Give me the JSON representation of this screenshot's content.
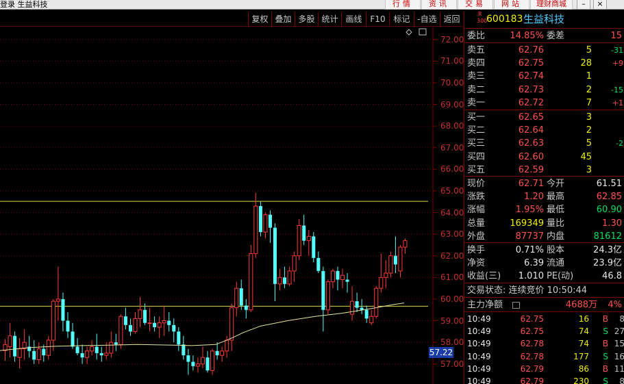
{
  "app": {
    "title": "登录 生益科技"
  },
  "top_nav": [
    "行情",
    "资讯",
    "交易",
    "网站",
    "理财商城"
  ],
  "window_controls": [
    "–",
    "×"
  ],
  "toolbar": [
    "复权",
    "叠加",
    "多股",
    "统计",
    "画线",
    "F10",
    "标记",
    "-自选",
    "返回"
  ],
  "chart": {
    "y_labels": [
      "72.00",
      "71.00",
      "70.00",
      "69.00",
      "68.00",
      "67.00",
      "66.00",
      "65.00",
      "64.00",
      "63.00",
      "62.00",
      "61.00",
      "60.00",
      "59.00",
      "58.00",
      "57.00"
    ],
    "current_marker": "57.22",
    "colors": {
      "up": "#ff3a3a",
      "down": "#54fcfc",
      "ma": "#e8e8a0",
      "hline": "#d8d850",
      "grid": "#7a0000"
    }
  },
  "chart_data": {
    "type": "candlestick",
    "ylim": [
      56.5,
      72.5
    ],
    "hlines": [
      64.52,
      59.67
    ],
    "candles": [
      [
        57.62,
        58.15,
        57.15,
        57.9
      ],
      [
        57.8,
        58.9,
        57.3,
        58.3
      ],
      [
        58.3,
        58.5,
        57.1,
        57.35
      ],
      [
        57.3,
        58.2,
        56.8,
        57.7
      ],
      [
        57.7,
        58.6,
        57.2,
        58.0
      ],
      [
        57.8,
        58.3,
        57.3,
        57.6
      ],
      [
        57.6,
        58.1,
        57.0,
        57.2
      ],
      [
        57.2,
        58.0,
        57.0,
        57.7
      ],
      [
        57.7,
        57.9,
        57.1,
        57.4
      ],
      [
        57.4,
        58.3,
        57.2,
        58.1
      ],
      [
        58.1,
        60.0,
        57.6,
        59.9
      ],
      [
        59.9,
        61.5,
        59.0,
        60.0
      ],
      [
        60.0,
        60.3,
        58.5,
        59.0
      ],
      [
        59.0,
        59.4,
        58.2,
        58.5
      ],
      [
        58.5,
        58.9,
        57.7,
        57.8
      ],
      [
        57.8,
        58.2,
        57.4,
        57.5
      ],
      [
        57.5,
        57.9,
        57.0,
        57.3
      ],
      [
        57.3,
        57.8,
        57.0,
        57.6
      ],
      [
        57.6,
        58.1,
        57.4,
        57.8
      ],
      [
        57.8,
        58.4,
        57.2,
        57.5
      ],
      [
        57.5,
        57.8,
        57.1,
        57.4
      ],
      [
        57.4,
        58.0,
        57.2,
        57.5
      ],
      [
        57.5,
        58.5,
        57.3,
        58.0
      ],
      [
        58.0,
        58.4,
        57.6,
        57.9
      ],
      [
        57.9,
        59.3,
        57.7,
        59.2
      ],
      [
        59.2,
        59.6,
        58.6,
        58.8
      ],
      [
        58.8,
        59.1,
        58.3,
        58.5
      ],
      [
        58.5,
        59.4,
        58.4,
        59.1
      ],
      [
        59.1,
        60.1,
        58.7,
        59.5
      ],
      [
        59.5,
        59.8,
        58.8,
        58.9
      ],
      [
        58.9,
        59.6,
        58.5,
        58.9
      ],
      [
        58.9,
        59.2,
        58.5,
        58.7
      ],
      [
        58.7,
        59.2,
        58.2,
        58.9
      ],
      [
        58.9,
        59.7,
        58.3,
        59.0
      ],
      [
        59.0,
        59.4,
        58.5,
        58.8
      ],
      [
        58.8,
        59.1,
        58.0,
        58.5
      ],
      [
        58.5,
        58.7,
        57.6,
        57.9
      ],
      [
        57.9,
        58.3,
        57.2,
        57.4
      ],
      [
        57.4,
        57.7,
        56.5,
        57.1
      ],
      [
        57.1,
        57.4,
        56.7,
        56.9
      ],
      [
        56.9,
        57.3,
        56.6,
        57.0
      ],
      [
        57.0,
        57.8,
        56.8,
        57.3
      ],
      [
        57.3,
        57.6,
        56.6,
        56.7
      ],
      [
        56.7,
        57.7,
        56.5,
        57.6
      ],
      [
        57.6,
        58.0,
        57.2,
        57.4
      ],
      [
        57.4,
        57.8,
        57.1,
        57.6
      ],
      [
        57.6,
        58.3,
        57.3,
        58.1
      ],
      [
        58.1,
        59.8,
        57.6,
        59.6
      ],
      [
        59.6,
        60.8,
        59.2,
        60.5
      ],
      [
        60.5,
        60.9,
        59.5,
        59.7
      ],
      [
        59.7,
        60.0,
        59.1,
        59.5
      ],
      [
        59.5,
        62.5,
        59.4,
        62.1
      ],
      [
        62.1,
        64.9,
        61.9,
        64.3
      ],
      [
        64.3,
        64.5,
        62.9,
        63.1
      ],
      [
        63.1,
        64.0,
        62.8,
        63.9
      ],
      [
        63.9,
        64.1,
        62.6,
        63.3
      ],
      [
        63.3,
        63.5,
        59.9,
        60.7
      ],
      [
        60.7,
        61.4,
        60.4,
        61.0
      ],
      [
        61.0,
        61.5,
        60.5,
        60.7
      ],
      [
        60.7,
        61.5,
        60.6,
        61.3
      ],
      [
        61.3,
        62.2,
        60.8,
        62.0
      ],
      [
        62.0,
        63.7,
        61.8,
        63.4
      ],
      [
        63.4,
        63.9,
        62.5,
        62.7
      ],
      [
        62.7,
        63.2,
        62.0,
        62.9
      ],
      [
        62.9,
        63.1,
        61.7,
        61.9
      ],
      [
        61.9,
        62.2,
        61.2,
        61.3
      ],
      [
        61.3,
        61.5,
        58.5,
        59.5
      ],
      [
        59.5,
        60.9,
        59.3,
        60.8
      ],
      [
        60.8,
        61.4,
        60.5,
        61.3
      ],
      [
        61.3,
        61.5,
        60.4,
        60.9
      ],
      [
        60.9,
        61.4,
        60.5,
        61.1
      ],
      [
        60.9,
        61.2,
        60.3,
        60.8
      ],
      [
        59.3,
        60.6,
        59.0,
        59.9
      ],
      [
        59.9,
        60.3,
        59.4,
        59.6
      ],
      [
        59.6,
        60.0,
        59.3,
        59.5
      ],
      [
        59.5,
        59.7,
        58.9,
        59.1
      ],
      [
        58.9,
        59.5,
        58.8,
        59.2
      ],
      [
        59.2,
        60.6,
        59.1,
        60.5
      ],
      [
        60.5,
        62.1,
        60.3,
        61.0
      ],
      [
        61.0,
        61.8,
        60.5,
        61.2
      ],
      [
        61.2,
        62.2,
        61.0,
        62.0
      ],
      [
        62.0,
        62.9,
        61.2,
        61.6
      ],
      [
        61.3,
        62.5,
        61.0,
        62.4
      ],
      [
        62.4,
        62.8,
        62.1,
        62.7
      ]
    ],
    "ma": [
      [
        0,
        57.62
      ],
      [
        40,
        57.75
      ],
      [
        80,
        57.82
      ],
      [
        120,
        57.85
      ],
      [
        160,
        57.87
      ],
      [
        200,
        57.9
      ],
      [
        240,
        57.88
      ],
      [
        280,
        57.85
      ],
      [
        315,
        57.9
      ],
      [
        335,
        58.15
      ],
      [
        355,
        58.45
      ],
      [
        380,
        58.75
      ],
      [
        420,
        59.0
      ],
      [
        460,
        59.2
      ],
      [
        500,
        59.35
      ],
      [
        540,
        59.55
      ],
      [
        575,
        59.75
      ],
      [
        590,
        59.82
      ]
    ]
  },
  "panel": {
    "symbol": "600183",
    "name": "生益科技",
    "market_tag_top": "R",
    "market_tag_bottom": "300",
    "weibi": {
      "label": "委比",
      "value": "14.85%",
      "label2": "委差",
      "value2": "15"
    },
    "asks": [
      {
        "label": "卖五",
        "price": "62.76",
        "vol": "5",
        "chg": "-31"
      },
      {
        "label": "卖四",
        "price": "62.75",
        "vol": "28",
        "chg": "+9"
      },
      {
        "label": "卖三",
        "price": "62.74",
        "vol": "1",
        "chg": ""
      },
      {
        "label": "卖二",
        "price": "62.73",
        "vol": "2",
        "chg": "-15"
      },
      {
        "label": "卖一",
        "price": "62.72",
        "vol": "7",
        "chg": "+1"
      }
    ],
    "bids": [
      {
        "label": "买一",
        "price": "62.65",
        "vol": "3",
        "chg": ""
      },
      {
        "label": "买二",
        "price": "62.64",
        "vol": "2",
        "chg": ""
      },
      {
        "label": "买三",
        "price": "62.63",
        "vol": "5",
        "chg": "-2"
      },
      {
        "label": "买四",
        "price": "62.60",
        "vol": "45",
        "chg": ""
      },
      {
        "label": "买五",
        "price": "62.59",
        "vol": "3",
        "chg": ""
      }
    ],
    "quote": [
      {
        "l1": "现价",
        "v1": "62.71",
        "l2": "今开",
        "v2": "61.51"
      },
      {
        "l1": "涨跌",
        "v1": "1.20",
        "l2": "最高",
        "v2": "62.85"
      },
      {
        "l1": "涨幅",
        "v1": "1.95%",
        "l2": "最低",
        "v2": "60.90"
      },
      {
        "l1": "总量",
        "v1": "169349",
        "l2": "量比",
        "v2": "1.30"
      },
      {
        "l1": "外盘",
        "v1": "87737",
        "l2": "内盘",
        "v2": "81612"
      }
    ],
    "stats": [
      {
        "l1": "换手",
        "v1": "0.71%",
        "l2": "股本",
        "v2": "24.3亿"
      },
      {
        "l1": "净资",
        "v1": "6.39",
        "l2": "流通",
        "v2": "23.9亿"
      },
      {
        "l1": "收益(三)",
        "v1": "1.010",
        "l2": "PE(动)",
        "v2": "46.8"
      }
    ],
    "trade_status": "交易状态: 连续竞价 10:50:44",
    "main_flow": {
      "label": "主力净额",
      "value": "4688万",
      "pct": "4%"
    },
    "ticks": [
      {
        "time": "10:49",
        "price": "62.75",
        "vol": "16",
        "dir": "B",
        "n": "8"
      },
      {
        "time": "10:49",
        "price": "62.75",
        "vol": "74",
        "dir": "S",
        "n": "27"
      },
      {
        "time": "10:49",
        "price": "62.78",
        "vol": "74",
        "dir": "B",
        "n": "15"
      },
      {
        "time": "10:49",
        "price": "62.78",
        "vol": "177",
        "dir": "S",
        "n": "16"
      },
      {
        "time": "10:49",
        "price": "62.79",
        "vol": "86",
        "dir": "B",
        "n": "11"
      },
      {
        "time": "10:49",
        "price": "62.79",
        "vol": "230",
        "dir": "S",
        "n": "8"
      }
    ]
  }
}
